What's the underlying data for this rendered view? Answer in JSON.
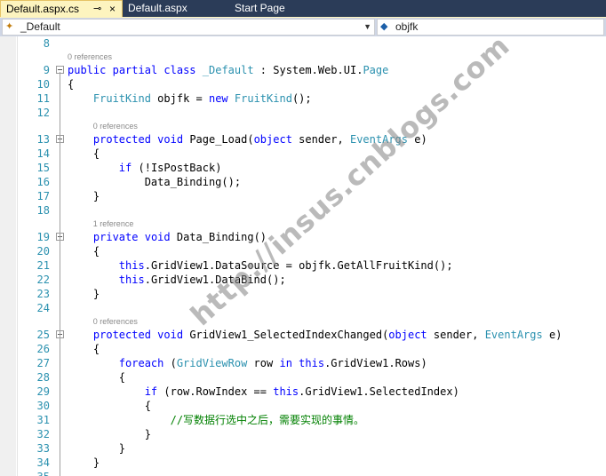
{
  "tabs": [
    {
      "label": "Default.aspx.cs",
      "pin": "⊸",
      "close": "×",
      "active": true
    },
    {
      "label": "Default.aspx"
    },
    {
      "label": "Start Page"
    }
  ],
  "navbar": {
    "left_combo": {
      "icon": "class-icon",
      "value": "_Default"
    },
    "right_combo": {
      "icon": "field-icon",
      "value": "objfk"
    }
  },
  "editor": {
    "lines": [
      {
        "num": "8",
        "code": ""
      },
      {
        "num": "9",
        "code": "public partial class _Default : System.Web.UI.Page",
        "lens": "0 references"
      },
      {
        "num": "10",
        "code": "{"
      },
      {
        "num": "11",
        "code": "    FruitKind objfk = new FruitKind();"
      },
      {
        "num": "12",
        "code": ""
      },
      {
        "num": "13",
        "code": "    protected void Page_Load(object sender, EventArgs e)",
        "lens": "0 references"
      },
      {
        "num": "14",
        "code": "    {"
      },
      {
        "num": "15",
        "code": "        if (!IsPostBack)"
      },
      {
        "num": "16",
        "code": "            Data_Binding();"
      },
      {
        "num": "17",
        "code": "    }"
      },
      {
        "num": "18",
        "code": ""
      },
      {
        "num": "19",
        "code": "    private void Data_Binding()",
        "lens": "1 reference"
      },
      {
        "num": "20",
        "code": "    {"
      },
      {
        "num": "21",
        "code": "        this.GridView1.DataSource = objfk.GetAllFruitKind();"
      },
      {
        "num": "22",
        "code": "        this.GridView1.DataBind();"
      },
      {
        "num": "23",
        "code": "    }"
      },
      {
        "num": "24",
        "code": ""
      },
      {
        "num": "25",
        "code": "    protected void GridView1_SelectedIndexChanged(object sender, EventArgs e)",
        "lens": "0 references"
      },
      {
        "num": "26",
        "code": "    {"
      },
      {
        "num": "27",
        "code": "        foreach (GridViewRow row in this.GridView1.Rows)"
      },
      {
        "num": "28",
        "code": "        {"
      },
      {
        "num": "29",
        "code": "            if (row.RowIndex == this.GridView1.SelectedIndex)"
      },
      {
        "num": "30",
        "code": "            {"
      },
      {
        "num": "31",
        "code": "                //写数据行选中之后，需要实现的事情。"
      },
      {
        "num": "32",
        "code": "            }"
      },
      {
        "num": "33",
        "code": "        }"
      },
      {
        "num": "34",
        "code": "    }"
      },
      {
        "num": "35",
        "code": ""
      }
    ]
  },
  "watermark": "http://insus.cnblogs.com",
  "colors": {
    "keyword": "#0000ff",
    "type": "#2b91af",
    "comment": "#008000",
    "line_number": "#2b91af",
    "tab_bar": "#2b3c58",
    "active_tab": "#fdf4bf"
  }
}
